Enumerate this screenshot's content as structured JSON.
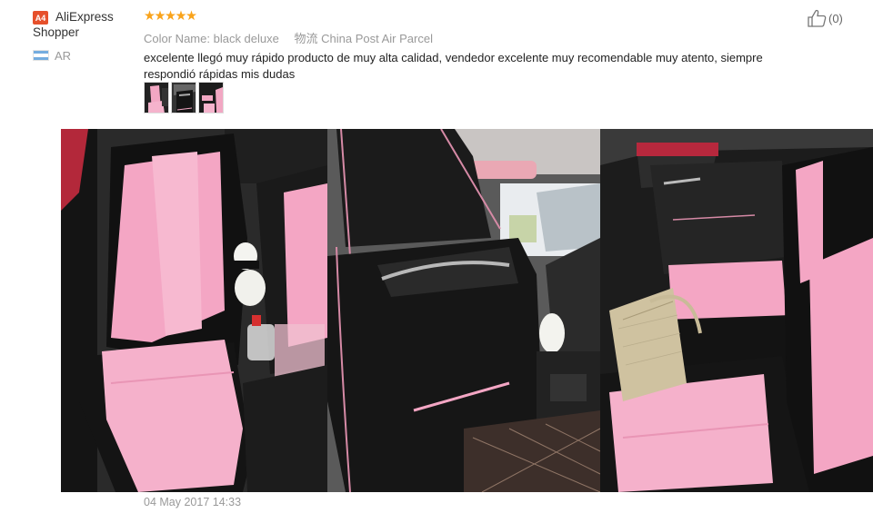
{
  "reviewer": {
    "badge": "A4",
    "name": "AliExpress Shopper",
    "country": "AR",
    "flag_colors": [
      "#74acdf",
      "#ffffff",
      "#74acdf"
    ]
  },
  "rating": {
    "stars": 5,
    "display": "★★★★★"
  },
  "attributes": {
    "color_label": "Color Name:",
    "color_value": "black deluxe",
    "logistics_label": "物流",
    "logistics_value": "China Post Air Parcel"
  },
  "review": {
    "text": "excelente llegó muy rápido producto de muy alta calidad, vendedor excelente muy recomendable muy atento, siempre respondió rápidas mis dudas"
  },
  "helpful": {
    "count": "(0)"
  },
  "photos": {
    "thumbnail_count": 3,
    "expanded_count": 3
  },
  "date": "04 May 2017 14:33",
  "colors": {
    "star": "#f9a31b",
    "accent": "#e6502b",
    "pink": "#f4a6c4",
    "leather_black": "#1a1a1a"
  }
}
